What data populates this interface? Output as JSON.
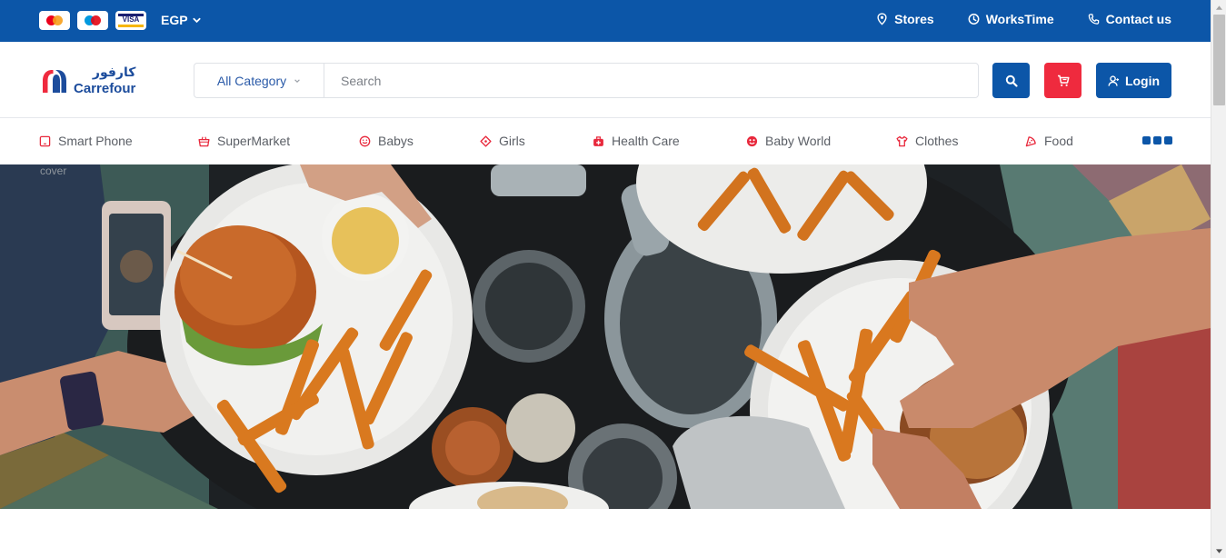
{
  "topbar": {
    "payment_cards": [
      {
        "name": "mastercard"
      },
      {
        "name": "maestro"
      },
      {
        "name": "visa",
        "label": "VISA"
      }
    ],
    "currency": "EGP",
    "links": [
      {
        "label": "Stores",
        "icon": "location-pin-icon"
      },
      {
        "label": "WorksTime",
        "icon": "clock-icon"
      },
      {
        "label": "Contact us",
        "icon": "phone-icon"
      }
    ],
    "bg_color": "#0c56a8"
  },
  "header": {
    "logo_arabic": "كارفور",
    "logo_latin": "Carrefour",
    "category_select": "All Category",
    "search_placeholder": "Search",
    "login_label": "Login",
    "accent_blue": "#0c56a8",
    "accent_red": "#ef2a3e"
  },
  "categories": [
    {
      "label": "Smart Phone",
      "icon": "phone-icon"
    },
    {
      "label": "SuperMarket",
      "icon": "basket-icon"
    },
    {
      "label": "Babys",
      "icon": "baby-face-icon"
    },
    {
      "label": "Girls",
      "icon": "diamond-icon"
    },
    {
      "label": "Health Care",
      "icon": "medical-kit-icon"
    },
    {
      "label": "Baby World",
      "icon": "smile-icon"
    },
    {
      "label": "Clothes",
      "icon": "shirt-icon"
    },
    {
      "label": "Food",
      "icon": "pizza-icon"
    }
  ],
  "hero": {
    "alt_text": "cover"
  }
}
